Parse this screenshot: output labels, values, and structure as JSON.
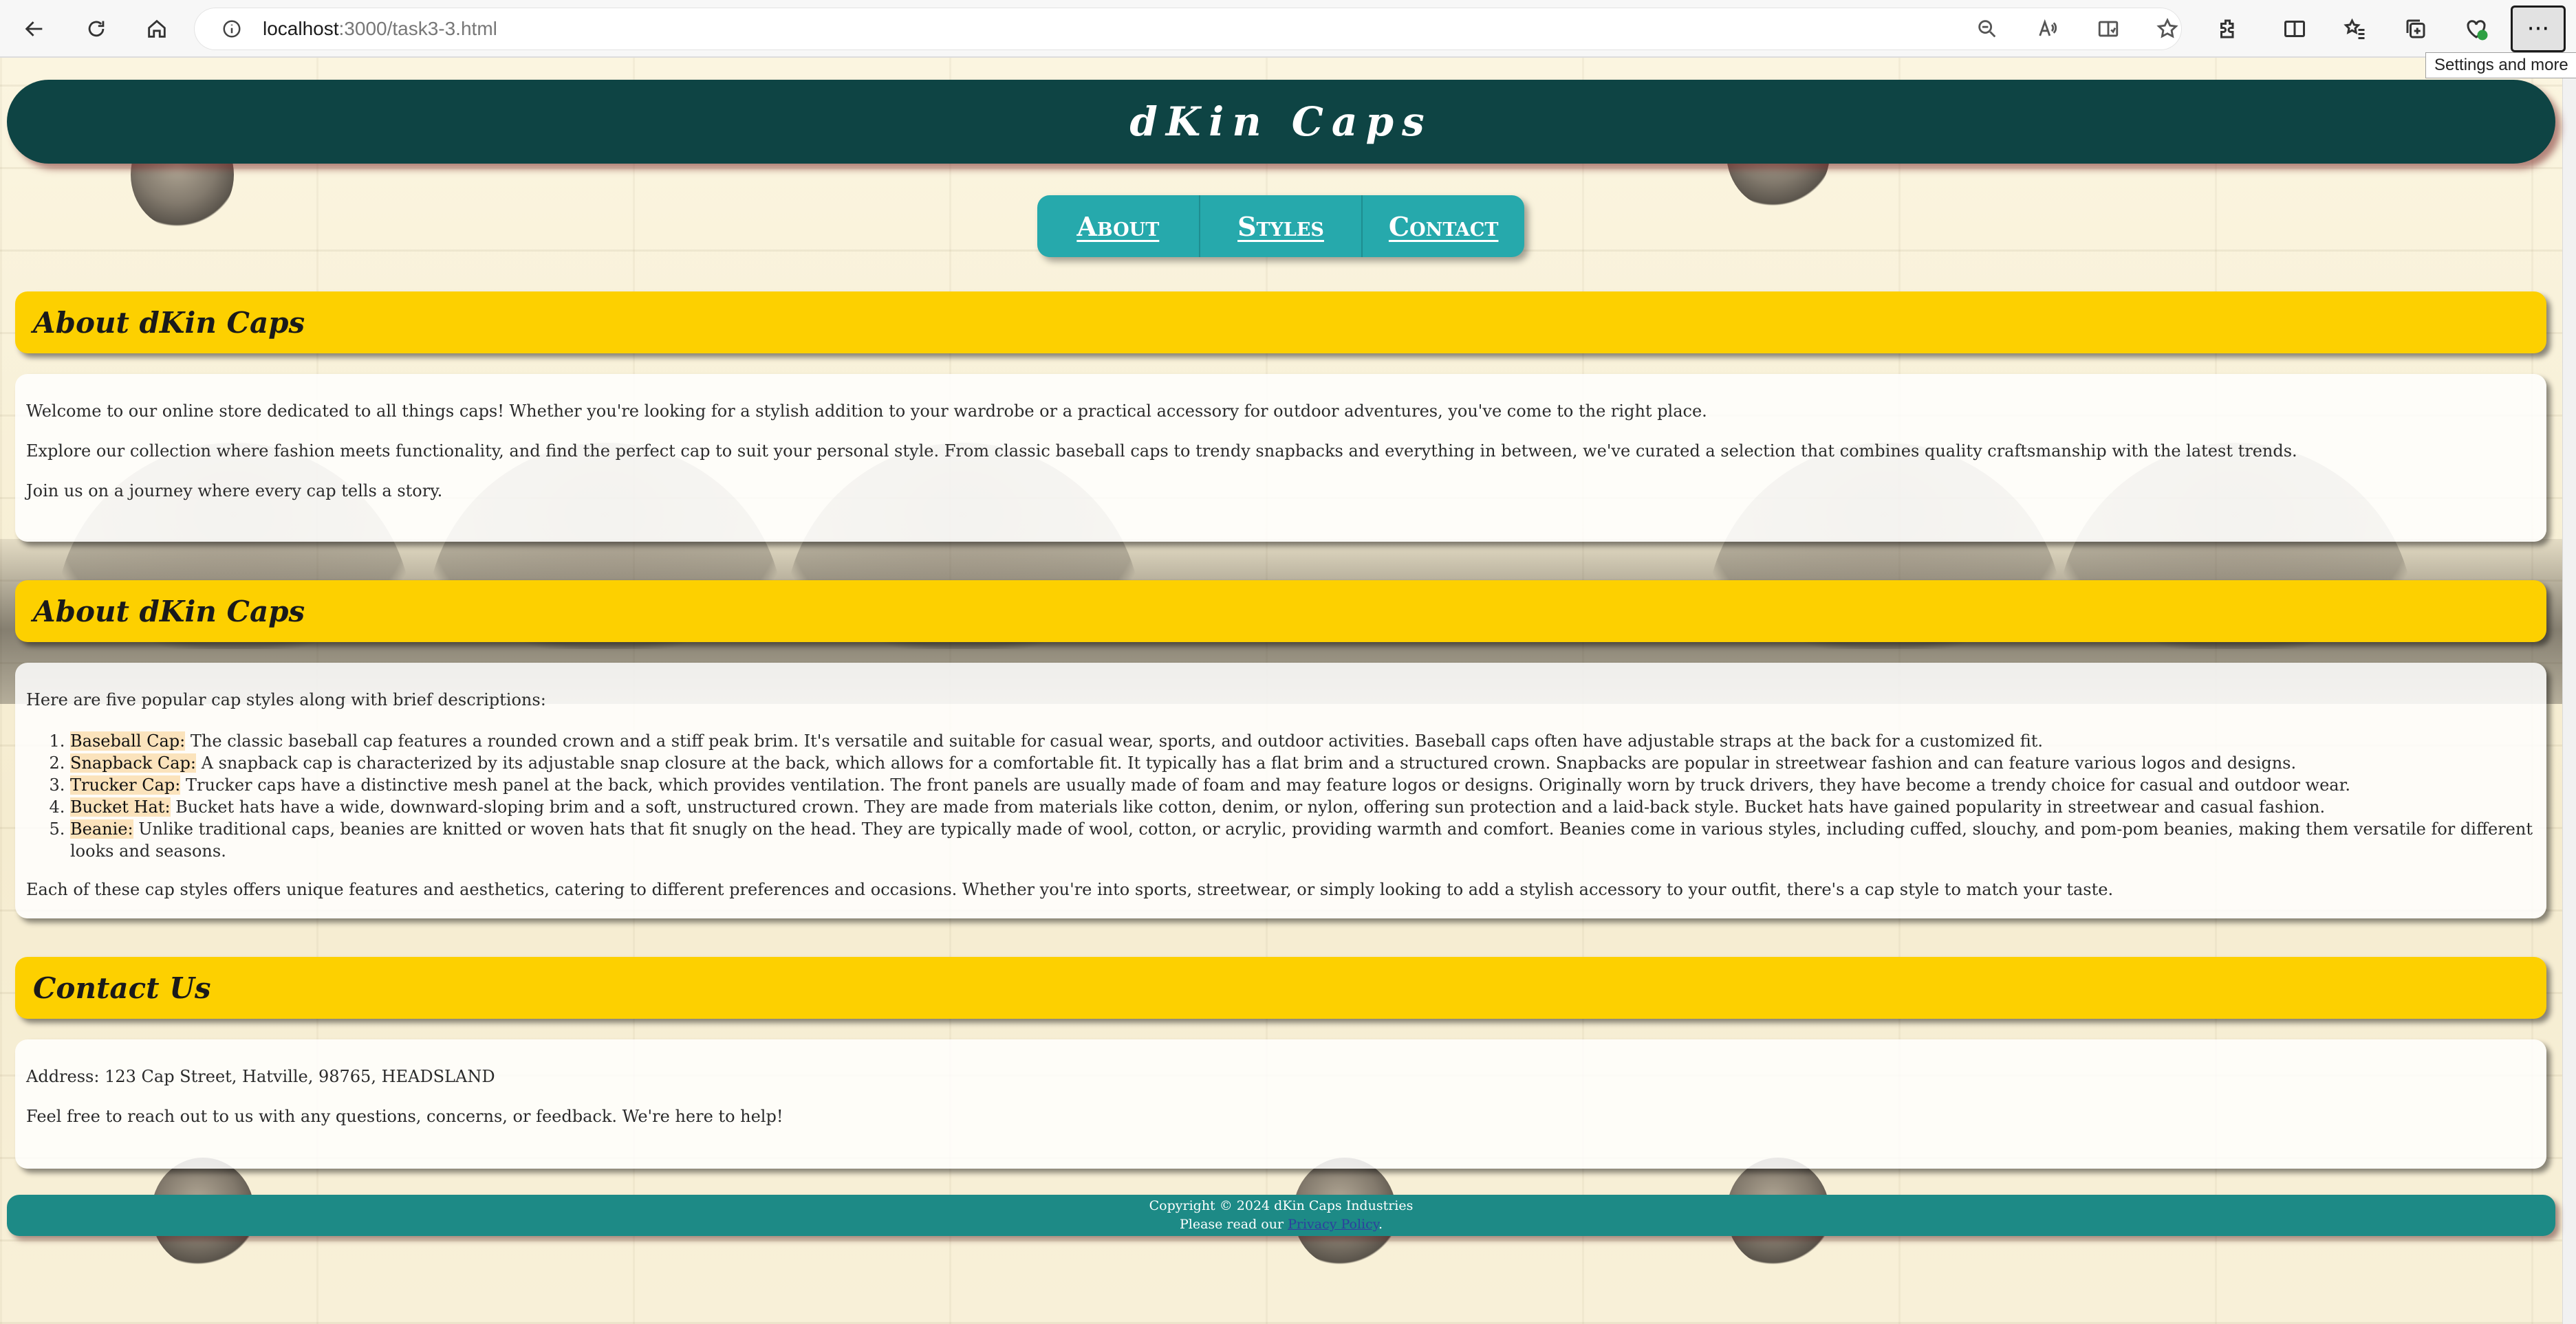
{
  "browser": {
    "url_host": "localhost",
    "url_path": ":3000/task3-3.html",
    "tooltip": "Settings and more",
    "more_label": "···"
  },
  "site": {
    "title": "dKin Caps"
  },
  "nav": {
    "items": [
      {
        "label": "About"
      },
      {
        "label": "Styles"
      },
      {
        "label": "Contact"
      }
    ]
  },
  "about": {
    "heading": "About dKin Caps",
    "paragraphs": [
      "Welcome to our online store dedicated to all things caps! Whether you're looking for a stylish addition to your wardrobe or a practical accessory for outdoor adventures, you've come to the right place.",
      "Explore our collection where fashion meets functionality, and find the perfect cap to suit your personal style. From classic baseball caps to trendy snapbacks and everything in between, we've curated a selection that combines quality craftsmanship with the latest trends.",
      "Join us on a journey where every cap tells a story."
    ]
  },
  "styles": {
    "heading": "About dKin Caps",
    "intro": "Here are five popular cap styles along with brief descriptions:",
    "items": [
      {
        "name": "Baseball Cap:",
        "desc": "The classic baseball cap features a rounded crown and a stiff peak brim. It's versatile and suitable for casual wear, sports, and outdoor activities. Baseball caps often have adjustable straps at the back for a customized fit."
      },
      {
        "name": "Snapback Cap:",
        "desc": "A snapback cap is characterized by its adjustable snap closure at the back, which allows for a comfortable fit. It typically has a flat brim and a structured crown. Snapbacks are popular in streetwear fashion and can feature various logos and designs."
      },
      {
        "name": "Trucker Cap:",
        "desc": "Trucker caps have a distinctive mesh panel at the back, which provides ventilation. The front panels are usually made of foam and may feature logos or designs. Originally worn by truck drivers, they have become a trendy choice for casual and outdoor wear."
      },
      {
        "name": "Bucket Hat:",
        "desc": "Bucket hats have a wide, downward-sloping brim and a soft, unstructured crown. They are made from materials like cotton, denim, or nylon, offering sun protection and a laid-back style. Bucket hats have gained popularity in streetwear and casual fashion."
      },
      {
        "name": "Beanie:",
        "desc": "Unlike traditional caps, beanies are knitted or woven hats that fit snugly on the head. They are typically made of wool, cotton, or acrylic, providing warmth and comfort. Beanies come in various styles, including cuffed, slouchy, and pom-pom beanies, making them versatile for different looks and seasons."
      }
    ],
    "outro": "Each of these cap styles offers unique features and aesthetics, catering to different preferences and occasions. Whether you're into sports, streetwear, or simply looking to add a stylish accessory to your outfit, there's a cap style to match your taste."
  },
  "contact": {
    "heading": "Contact Us",
    "address": "Address: 123 Cap Street, Hatville, 98765, HEADSLAND",
    "note": "Feel free to reach out to us with any questions, concerns, or feedback. We're here to help!"
  },
  "footer": {
    "copyright": "Copyright © 2024 dKin Caps Industries",
    "privacy_prefix": "Please read our ",
    "privacy_link": "Privacy Policy",
    "privacy_suffix": "."
  },
  "colors": {
    "header_bg": "#0e4444",
    "nav_bg": "#26a9ac",
    "section_header_bg": "#fdd000",
    "footer_bg": "#1d8a86",
    "style_highlight": "#fbe3bc"
  },
  "icons": [
    "back-icon",
    "reload-icon",
    "home-icon",
    "info-icon",
    "zoom-out-icon",
    "read-aloud-icon",
    "immersive-reader-icon",
    "favorite-star-icon",
    "extensions-icon",
    "split-screen-icon",
    "favorites-icon",
    "collections-icon",
    "browser-essentials-icon",
    "more-icon"
  ]
}
